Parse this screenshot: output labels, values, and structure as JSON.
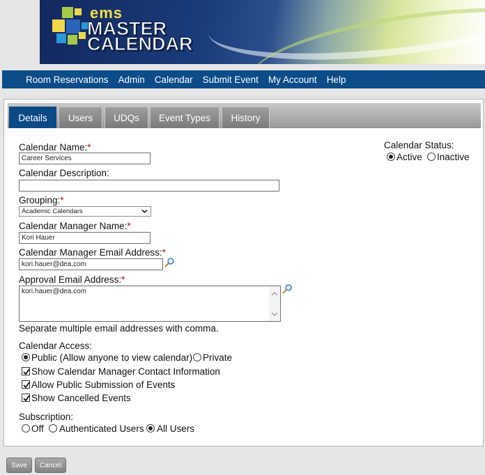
{
  "header": {
    "logo_small": "ems",
    "logo_line1": "MASTER",
    "logo_line2": "CALENDAR"
  },
  "nav": {
    "items": [
      "Room Reservations",
      "Admin",
      "Calendar",
      "Submit Event",
      "My Account",
      "Help"
    ]
  },
  "tabs": {
    "items": [
      "Details",
      "Users",
      "UDQs",
      "Event Types",
      "History"
    ],
    "active": "Details"
  },
  "form": {
    "calendar_name_label": "Calendar Name:",
    "calendar_name_value": "Career Services",
    "calendar_description_label": "Calendar Description:",
    "calendar_description_value": "",
    "grouping_label": "Grouping:",
    "grouping_value": "Academic Calendars",
    "manager_name_label": "Calendar Manager Name:",
    "manager_name_value": "Kori Hauer",
    "manager_email_label": "Calendar Manager Email Address:",
    "manager_email_value": "kori.hauer@dea.com",
    "approval_email_label": "Approval Email Address:",
    "approval_email_value": "kori.hauer@dea.com",
    "approval_hint": "Separate multiple email addresses with comma.",
    "required_mark": "*",
    "status_label": "Calendar Status:",
    "status_active": "Active",
    "status_inactive": "Inactive",
    "access_label": "Calendar Access:",
    "access_public": "Public (Allow anyone to view calendar)",
    "access_private": "Private",
    "show_manager_contact": "Show Calendar Manager Contact Information",
    "allow_public_submission": "Allow Public Submission of Events",
    "show_cancelled": "Show Cancelled Events",
    "subscription_label": "Subscription:",
    "sub_off": "Off",
    "sub_authenticated": "Authenticated Users",
    "sub_all": "All Users"
  },
  "buttons": {
    "save": "Save",
    "cancel": "Cancel"
  },
  "colors": {
    "nav_bg": "#0b4c89",
    "tab_active": "#0c4a86",
    "required": "#cc0000"
  }
}
